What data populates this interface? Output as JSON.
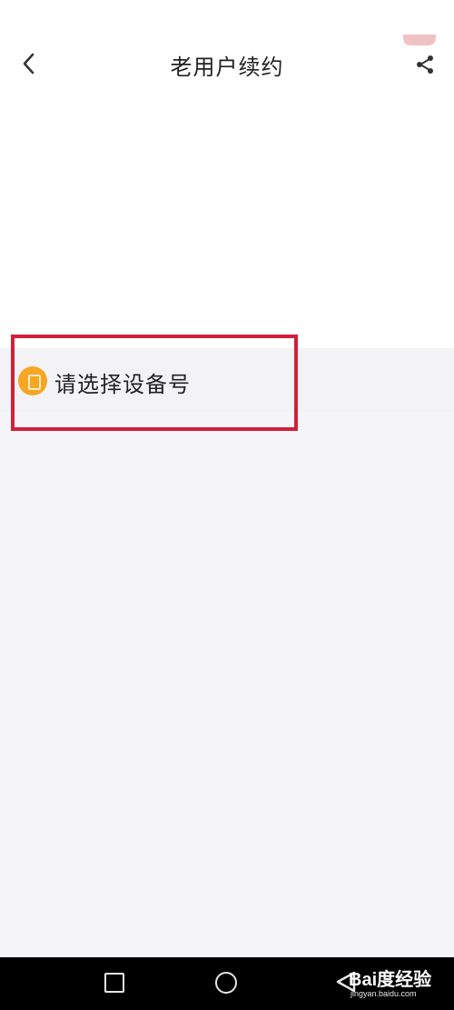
{
  "header": {
    "title": "老用户续约",
    "back_icon": "back-arrow-icon",
    "share_icon": "share-icon"
  },
  "device_selector": {
    "label": "请选择设备号",
    "icon": "device-icon",
    "icon_color": "#f5a623"
  },
  "annotation": {
    "highlight_color": "#d3203a"
  },
  "system_nav": {
    "recent_icon": "square-icon",
    "home_icon": "circle-icon",
    "back_icon": "triangle-back-icon"
  },
  "watermark": {
    "main": "Bai度经验",
    "sub": "jingyan.baidu.com"
  }
}
